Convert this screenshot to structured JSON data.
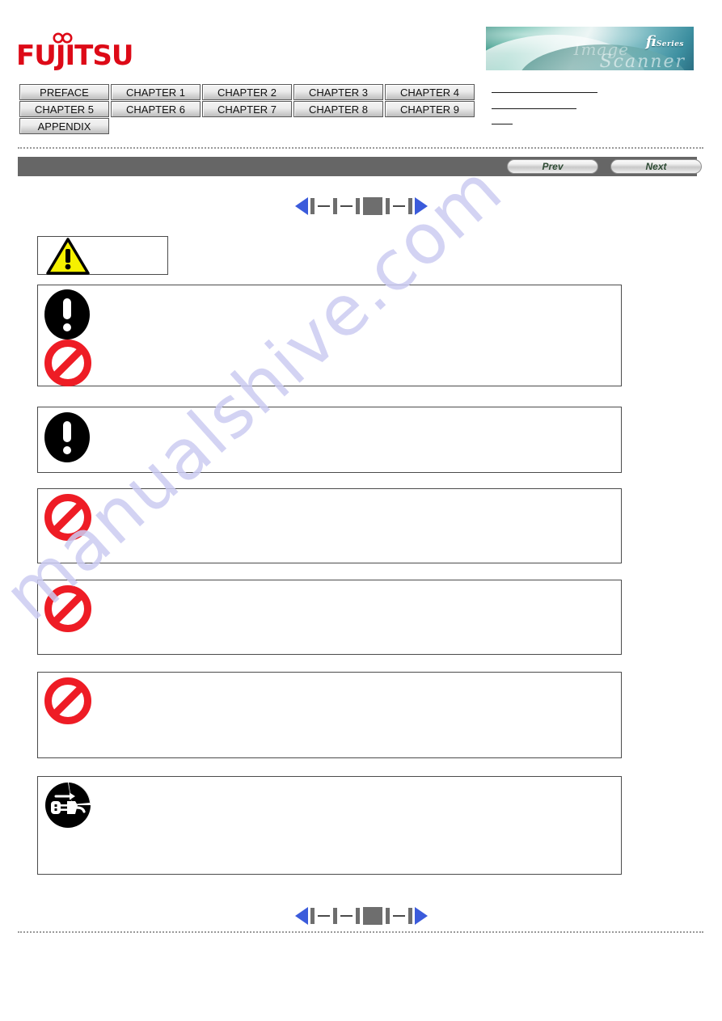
{
  "document": {
    "brand": "FUJITSU",
    "banner": {
      "series_text": "fi",
      "series_suffix": "Series",
      "script_top": "Image",
      "script_bottom": "Scanner"
    }
  },
  "nav_tabs": {
    "rows": [
      [
        "PREFACE",
        "CHAPTER 1",
        "CHAPTER 2",
        "CHAPTER 3",
        "CHAPTER 4"
      ],
      [
        "CHAPTER 5",
        "CHAPTER 6",
        "CHAPTER 7",
        "CHAPTER 8",
        "CHAPTER 9"
      ],
      [
        "APPENDIX"
      ]
    ]
  },
  "toolbar": {
    "prev_label": "Prev",
    "next_label": "Next"
  },
  "pager": {
    "prev_arrow": "left-triangle",
    "next_arrow": "right-triangle",
    "current_index": 3,
    "total_marks": 5
  },
  "icons": {
    "warning": "warning-triangle-icon",
    "mandatory": "mandatory-exclamation-icon",
    "prohibit": "prohibition-icon",
    "unplug": "unplug-power-cord-icon"
  },
  "notice_boxes": [
    {
      "id": "warning-header",
      "icons": [
        "warning"
      ],
      "text": ""
    },
    {
      "id": "notice-1",
      "icons": [
        "mandatory",
        "prohibit"
      ],
      "text": ""
    },
    {
      "id": "notice-2",
      "icons": [
        "mandatory"
      ],
      "text": ""
    },
    {
      "id": "notice-3",
      "icons": [
        "prohibit"
      ],
      "text": ""
    },
    {
      "id": "notice-4",
      "icons": [
        "prohibit"
      ],
      "text": ""
    },
    {
      "id": "notice-5",
      "icons": [
        "prohibit"
      ],
      "text": ""
    },
    {
      "id": "notice-6",
      "icons": [
        "unplug"
      ],
      "text": ""
    }
  ],
  "watermark": {
    "text": "manualshive.com",
    "color": "#ccccf2"
  },
  "colors": {
    "brand_red": "#dd0a17",
    "navbar_gray": "#666666",
    "pager_blue": "#3b5bdb",
    "prohibit_red": "#ee1c25",
    "warning_yellow": "#f5f000",
    "tab_border": "#5a5a5a"
  }
}
